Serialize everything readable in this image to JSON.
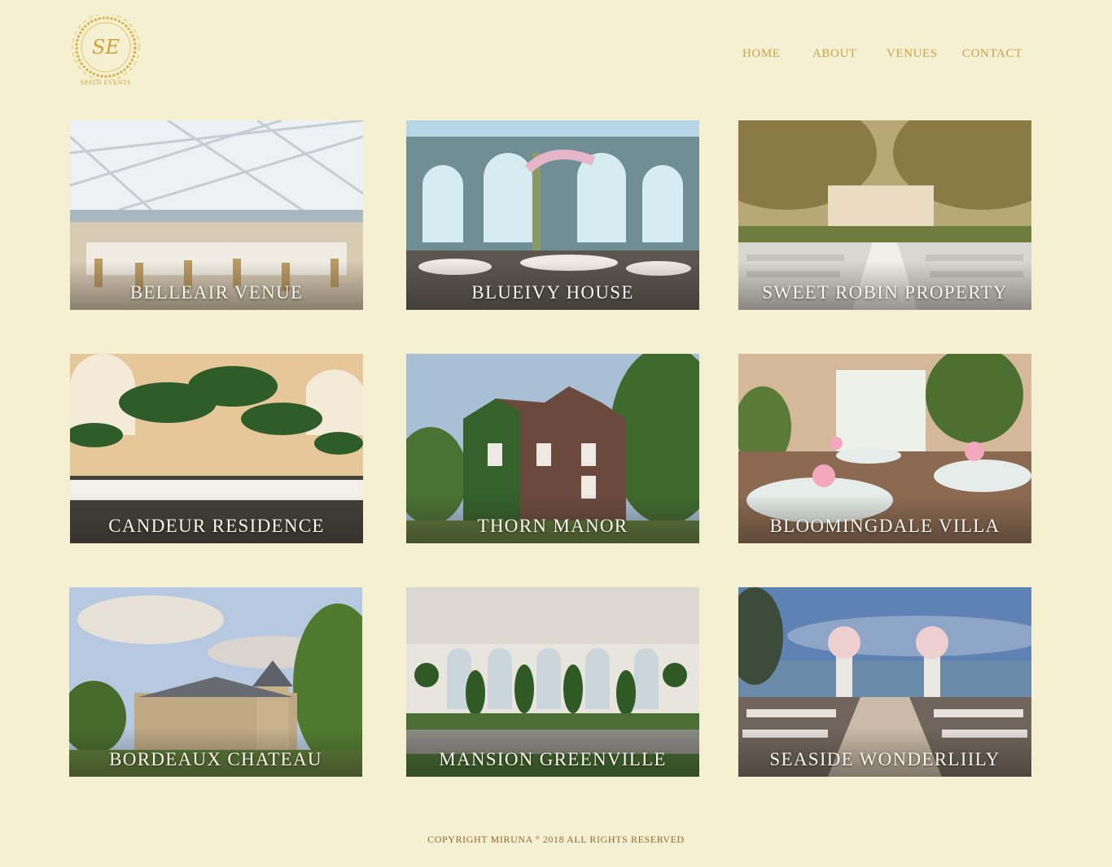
{
  "brand": {
    "monogram": "SE",
    "caption": "SPATII EVENTS",
    "accent": "#c9a43a"
  },
  "nav": {
    "items": [
      "HOME",
      "ABOUT",
      "VENUES",
      "CONTACT"
    ]
  },
  "venues": [
    {
      "name": "BELLEAIR VENUE"
    },
    {
      "name": "BLUEIVY HOUSE"
    },
    {
      "name": "SWEET ROBIN PROPERTY"
    },
    {
      "name": "CANDEUR RESIDENCE"
    },
    {
      "name": "THORN MANOR"
    },
    {
      "name": "BLOOMINGDALE VILLA"
    },
    {
      "name": "BORDEAUX CHATEAU"
    },
    {
      "name": "MANSION GREENVILLE"
    },
    {
      "name": "SEASIDE WONDERLIILY"
    }
  ],
  "footer": {
    "text": "Copyright Miruna ° 2018 All rights reserved"
  },
  "colors": {
    "background": "#f6f0d3",
    "nav_text": "#c4a44e",
    "footer_text": "#8b6a28"
  }
}
